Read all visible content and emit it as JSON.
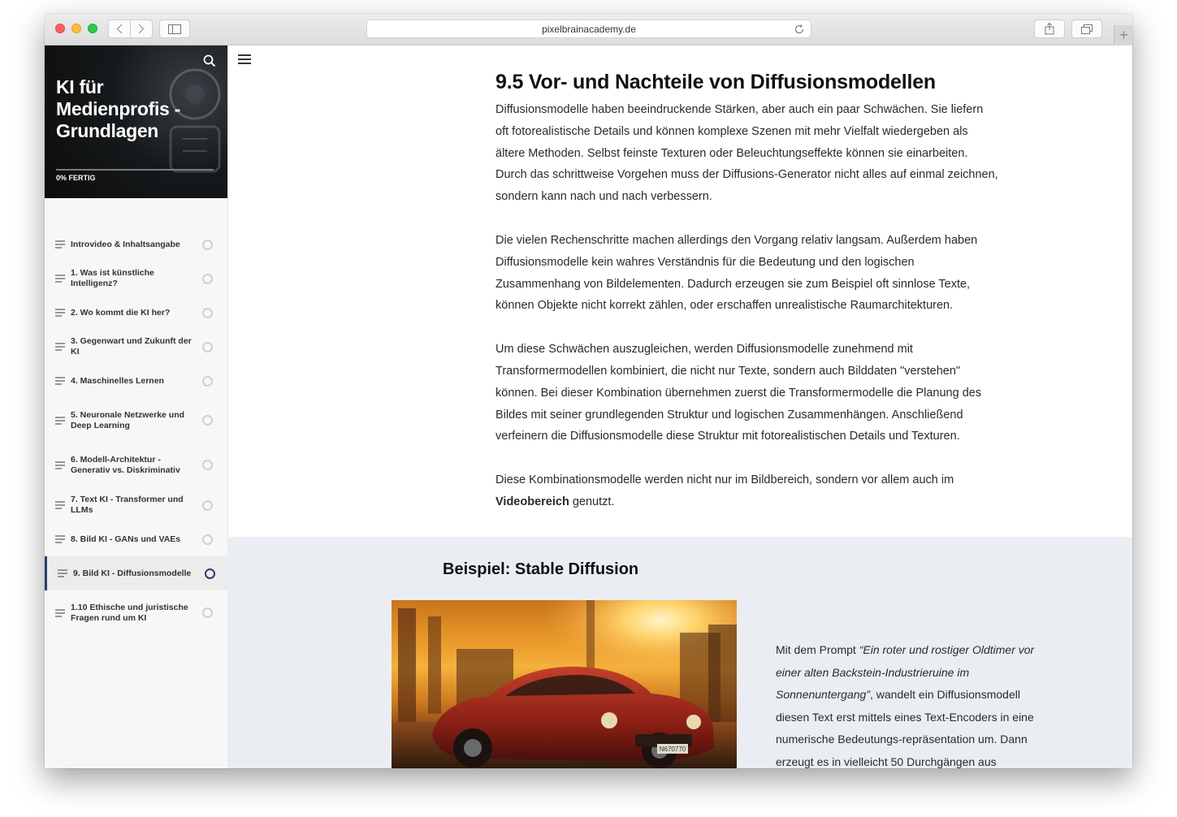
{
  "browser": {
    "url": "pixelbrainacademy.de"
  },
  "course": {
    "title": "KI für Medienprofis - Grundlagen",
    "progress": "0% FERTIG",
    "progress_value": 0
  },
  "lessons": [
    {
      "label": "Introvideo & Inhaltsangabe"
    },
    {
      "label": "1. Was ist künstliche Intelligenz?"
    },
    {
      "label": "2. Wo kommt die KI her?"
    },
    {
      "label": "3. Gegenwart und Zukunft der KI"
    },
    {
      "label": "4. Maschinelles Lernen"
    },
    {
      "label": "5. Neuronale Netzwerke und Deep Learning"
    },
    {
      "label": "6. Modell-Architektur - Generativ vs. Diskriminativ"
    },
    {
      "label": "7. Text KI - Transformer und LLMs"
    },
    {
      "label": "8. Bild KI - GANs und VAEs"
    },
    {
      "label": "9. Bild KI - Diffusionsmodelle"
    },
    {
      "label": "1.10 Ethische und juristische Fragen rund um KI"
    }
  ],
  "active_lesson": "9. Bild KI - Diffusionsmodelle",
  "main": {
    "heading": "9.5 Vor- und Nachteile von Diffusionsmodellen",
    "paragraph1": "Diffusionsmodelle haben beeindruckende Stärken, aber auch ein paar Schwächen. Sie liefern oft fotorealistische Details und können komplexe Szenen mit mehr Vielfalt wiedergeben als ältere Methoden. Selbst feinste Texturen oder Beleuchtungseffekte können sie einarbeiten. Durch das schrittweise Vorgehen muss der Diffusions-Generator nicht alles auf einmal zeichnen, sondern kann nach und nach verbessern.",
    "paragraph2": "Die vielen Rechenschritte machen allerdings den Vorgang relativ langsam. Außerdem haben Diffusionsmodelle kein wahres Verständnis für die Bedeutung und den logischen Zusammenhang von Bildelementen. Dadurch erzeugen sie zum Beispiel oft sinnlose Texte, können Objekte nicht korrekt zählen, oder erschaffen unrealistische Raumarchitekturen.",
    "paragraph3": "Um diese Schwächen auszugleichen, werden Diffusionsmodelle zunehmend mit Transformermodellen kombiniert, die nicht nur Texte, sondern auch Bilddaten \"verstehen\" können. Bei dieser Kombination übernehmen zuerst die Transformermodelle die Planung des Bildes mit seiner grundlegenden Struktur und logischen Zusammenhängen. Anschließend verfeinern die Diffusionsmodelle diese Struktur mit fotorealistischen Details und Texturen.",
    "paragraph4_pre": "Diese Kombinationsmodelle werden nicht nur im Bildbereich, sondern vor allem auch im ",
    "paragraph4_bold": "Videobereich",
    "paragraph4_post": " genutzt."
  },
  "example": {
    "heading": "Beispiel: Stable Diffusion",
    "image_plate": "N670770",
    "text_pre": "Mit dem Prompt ",
    "text_prompt": "“Ein roter und rostiger Oldtimer vor einer alten Backstein-Industrieruine im Sonnenuntergang”",
    "text_post": ", wandelt ein Diffusionsmodell diesen Text erst mittels eines Text-Encoders in eine numerische Bedeutungs-repräsentation um. Dann erzeugt es in vielleicht 50 Durchgängen aus"
  },
  "colors": {
    "accent": "#2c3e6b",
    "band": "#eaeef3",
    "hero": "#111314"
  },
  "icons": [
    "search-icon",
    "menu-icon",
    "list-lines-icon",
    "circle-status-icon",
    "reload-icon",
    "share-icon",
    "tabs-icon",
    "sidebar-toggle-icon",
    "back-icon",
    "forward-icon",
    "plus-icon"
  ]
}
